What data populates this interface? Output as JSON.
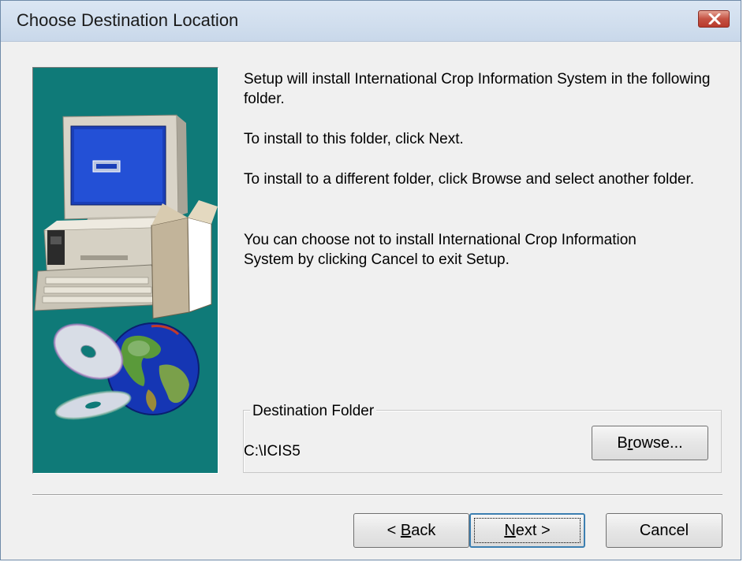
{
  "window": {
    "title": "Choose Destination Location",
    "close_icon": "close-icon"
  },
  "content": {
    "line1": "Setup will install International Crop Information System in the following folder.",
    "line2": "To install to this folder, click Next.",
    "line3": "To install to a different folder, click Browse and select another folder.",
    "line4": "You can choose not to install International Crop Information System by clicking Cancel to exit Setup."
  },
  "destination": {
    "group_label": "Destination Folder",
    "path": "C:\\ICIS5",
    "browse_prefix": "B",
    "browse_mnemonic": "r",
    "browse_suffix": "owse..."
  },
  "buttons": {
    "back_prefix": "< ",
    "back_mnemonic": "B",
    "back_suffix": "ack",
    "next_prefix": "",
    "next_mnemonic": "N",
    "next_suffix": "ext >",
    "cancel": "Cancel"
  },
  "colors": {
    "side_panel": "#0f7a78",
    "title_bar": "#c9d8ea",
    "close_button": "#c55243",
    "default_button_border": "#3c7fb1"
  }
}
